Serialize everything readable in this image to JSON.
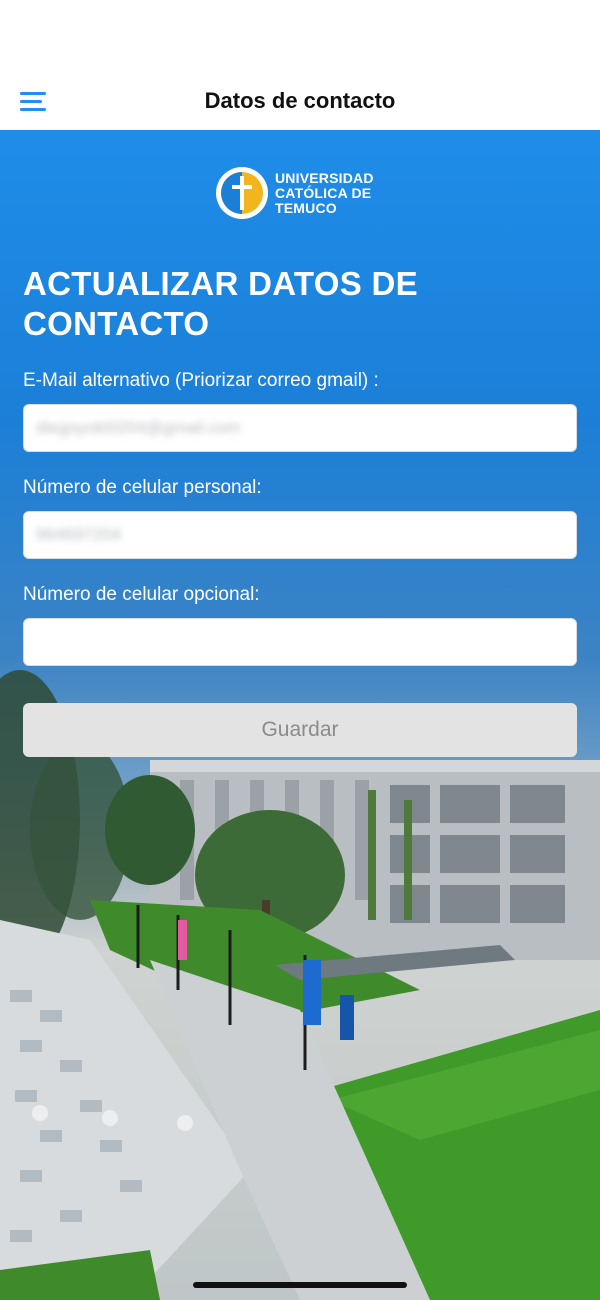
{
  "nav": {
    "title": "Datos de contacto",
    "menu_icon": "hamburger-menu-icon",
    "accent_color": "#1f8ff0"
  },
  "logo": {
    "line1": "UNIVERSIDAD",
    "line2": "CATÓLICA DE",
    "line3": "TEMUCO"
  },
  "form": {
    "heading": "ACTUALIZAR DATOS DE CONTACTO",
    "email_label": "E-Mail alternativo (Priorizar correo gmail) :",
    "email_value": "diegoyoki0204@gmail.com",
    "personal_phone_label": "Número de celular personal:",
    "personal_phone_value": "964697204",
    "optional_phone_label": "Número de celular opcional:",
    "optional_phone_value": "",
    "save_label": "Guardar"
  },
  "colors": {
    "header_blue": "#1e8de9",
    "button_disabled_bg": "#e3e3e3",
    "button_disabled_text": "#8b8b8b"
  }
}
